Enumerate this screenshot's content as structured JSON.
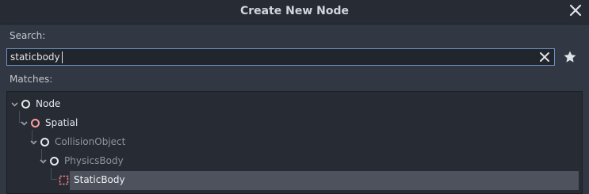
{
  "dialog": {
    "title": "Create New Node"
  },
  "search": {
    "label": "Search:",
    "value": "staticbody"
  },
  "matches": {
    "label": "Matches:"
  },
  "tree": {
    "items": [
      {
        "label": "Node",
        "depth": 0,
        "icon": "node-circle-icon",
        "dimmed": false,
        "selected": false
      },
      {
        "label": "Spatial",
        "depth": 1,
        "icon": "spatial-circle-icon",
        "dimmed": false,
        "selected": false
      },
      {
        "label": "CollisionObject",
        "depth": 2,
        "icon": "collision-object-circle-icon",
        "dimmed": true,
        "selected": false
      },
      {
        "label": "PhysicsBody",
        "depth": 3,
        "icon": "physics-body-circle-icon",
        "dimmed": true,
        "selected": false
      },
      {
        "label": "StaticBody",
        "depth": 4,
        "icon": "static-body-icon",
        "dimmed": false,
        "selected": true
      }
    ]
  },
  "colors": {
    "accent": "#6d91c4",
    "spatial": "#fc9c9c",
    "static_body": "#fc7f7f"
  }
}
